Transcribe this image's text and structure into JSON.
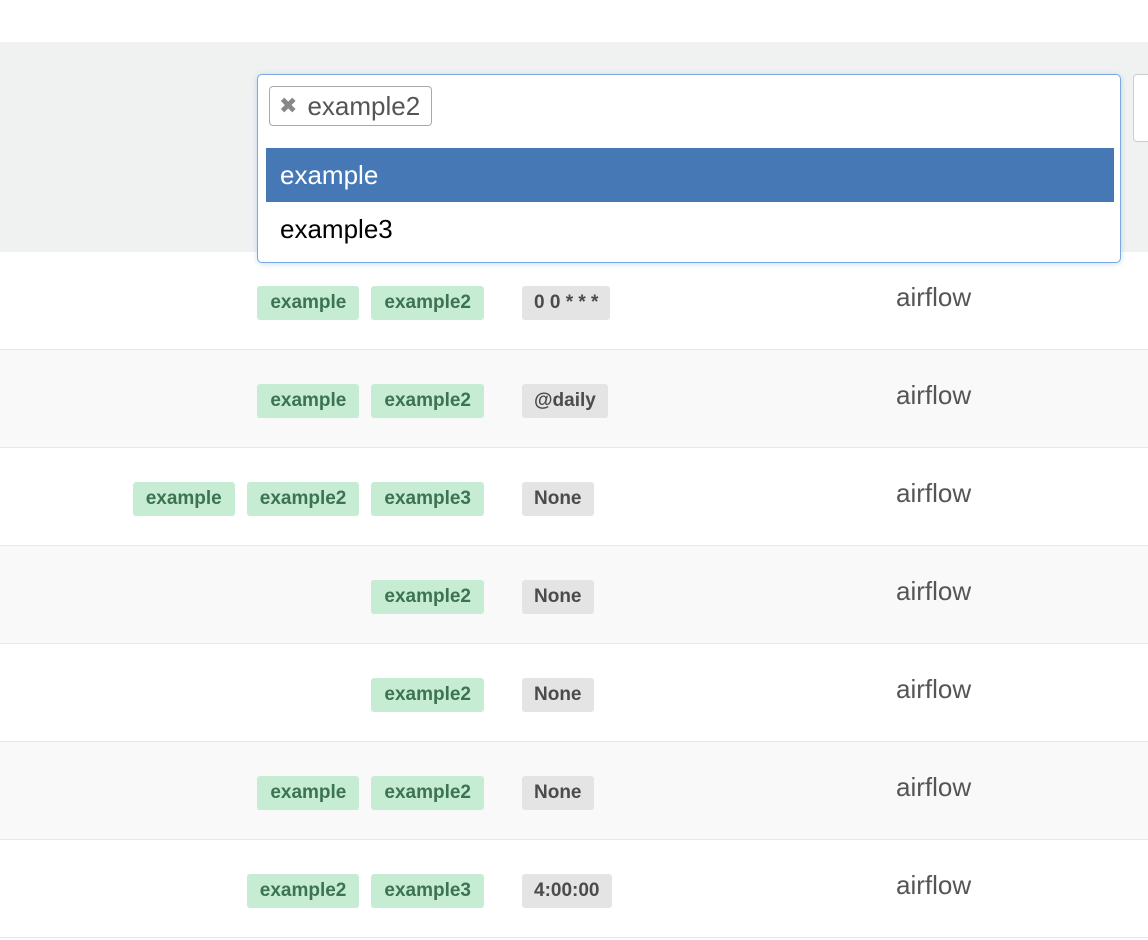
{
  "tag_filter": {
    "selected": [
      "example2"
    ],
    "remove_glyph": "✖",
    "options": [
      "example",
      "example3"
    ],
    "highlighted_index": 0
  },
  "dag_rows": [
    {
      "tags": [
        "example",
        "example2"
      ],
      "schedule": "0 0 * * *",
      "owner": "airflow"
    },
    {
      "tags": [
        "example",
        "example2"
      ],
      "schedule": "@daily",
      "owner": "airflow"
    },
    {
      "tags": [
        "example",
        "example2",
        "example3"
      ],
      "schedule": "None",
      "owner": "airflow"
    },
    {
      "tags": [
        "example2"
      ],
      "schedule": "None",
      "owner": "airflow"
    },
    {
      "tags": [
        "example2"
      ],
      "schedule": "None",
      "owner": "airflow"
    },
    {
      "tags": [
        "example",
        "example2"
      ],
      "schedule": "None",
      "owner": "airflow"
    },
    {
      "tags": [
        "example2",
        "example3"
      ],
      "schedule": "4:00:00",
      "owner": "airflow"
    }
  ],
  "colors": {
    "tag_bg": "#c6ecd3",
    "tag_text": "#3c7350",
    "schedule_bg": "#e4e4e4",
    "highlight": "#4578b5",
    "focus_border": "#79a9e0"
  }
}
